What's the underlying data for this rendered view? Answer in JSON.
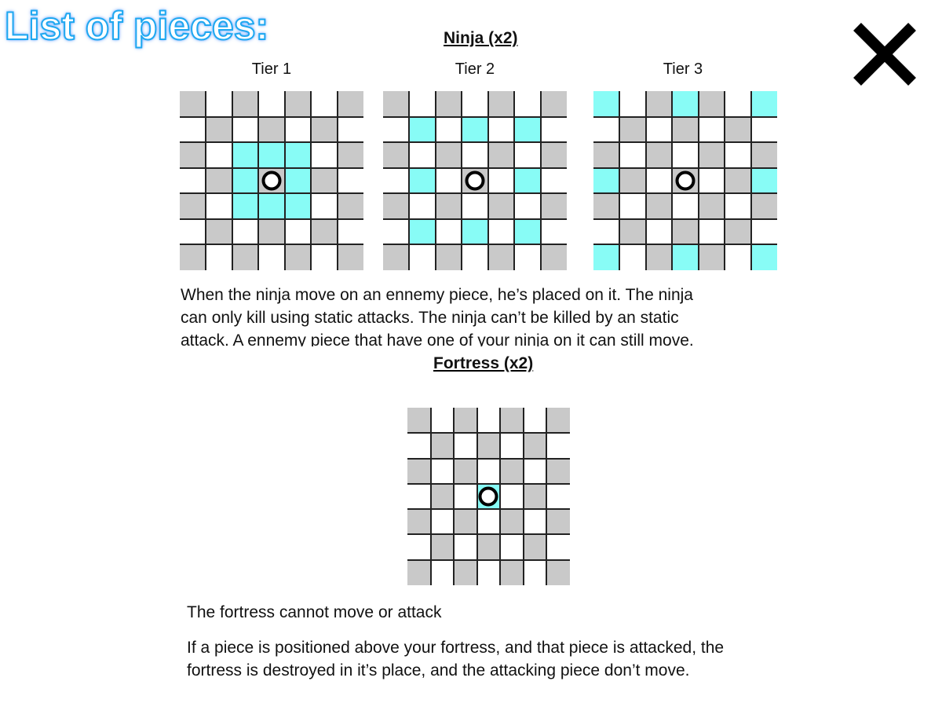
{
  "title": "List of pieces:",
  "close_icon": "close-x-icon",
  "ninja": {
    "heading": "Ninja (x2)",
    "tiers": [
      {
        "label": "Tier 1",
        "highlight": [
          [
            2,
            2
          ],
          [
            2,
            3
          ],
          [
            2,
            4
          ],
          [
            3,
            2
          ],
          [
            3,
            4
          ],
          [
            4,
            2
          ],
          [
            4,
            3
          ],
          [
            4,
            4
          ]
        ]
      },
      {
        "label": "Tier 2",
        "highlight": [
          [
            1,
            1
          ],
          [
            1,
            3
          ],
          [
            1,
            5
          ],
          [
            3,
            1
          ],
          [
            3,
            5
          ],
          [
            5,
            1
          ],
          [
            5,
            3
          ],
          [
            5,
            5
          ]
        ]
      },
      {
        "label": "Tier 3",
        "highlight": [
          [
            0,
            0
          ],
          [
            0,
            3
          ],
          [
            0,
            6
          ],
          [
            3,
            0
          ],
          [
            3,
            6
          ],
          [
            6,
            0
          ],
          [
            6,
            3
          ],
          [
            6,
            6
          ]
        ]
      }
    ],
    "description": [
      "When the ninja move on an ennemy piece, he’s placed on it. The ninja",
      "can only kill using static attacks. The ninja can’t be killed by an static",
      "attack. A ennemy piece that have one of your ninja on it can still move."
    ]
  },
  "fortress": {
    "heading": "Fortress (x2)",
    "highlight": [
      [
        3,
        3
      ]
    ],
    "line1": "The fortress cannot move or attack",
    "line2a": "If a piece is positioned above your fortress, and that piece is attacked, the",
    "line2b": "fortress is destroyed in it’s place, and the attacking piece don’t move."
  },
  "colors": {
    "highlight": "#88fcf6",
    "dark_cell": "#c9c9c9",
    "title_outline": "#1ea8f0"
  }
}
